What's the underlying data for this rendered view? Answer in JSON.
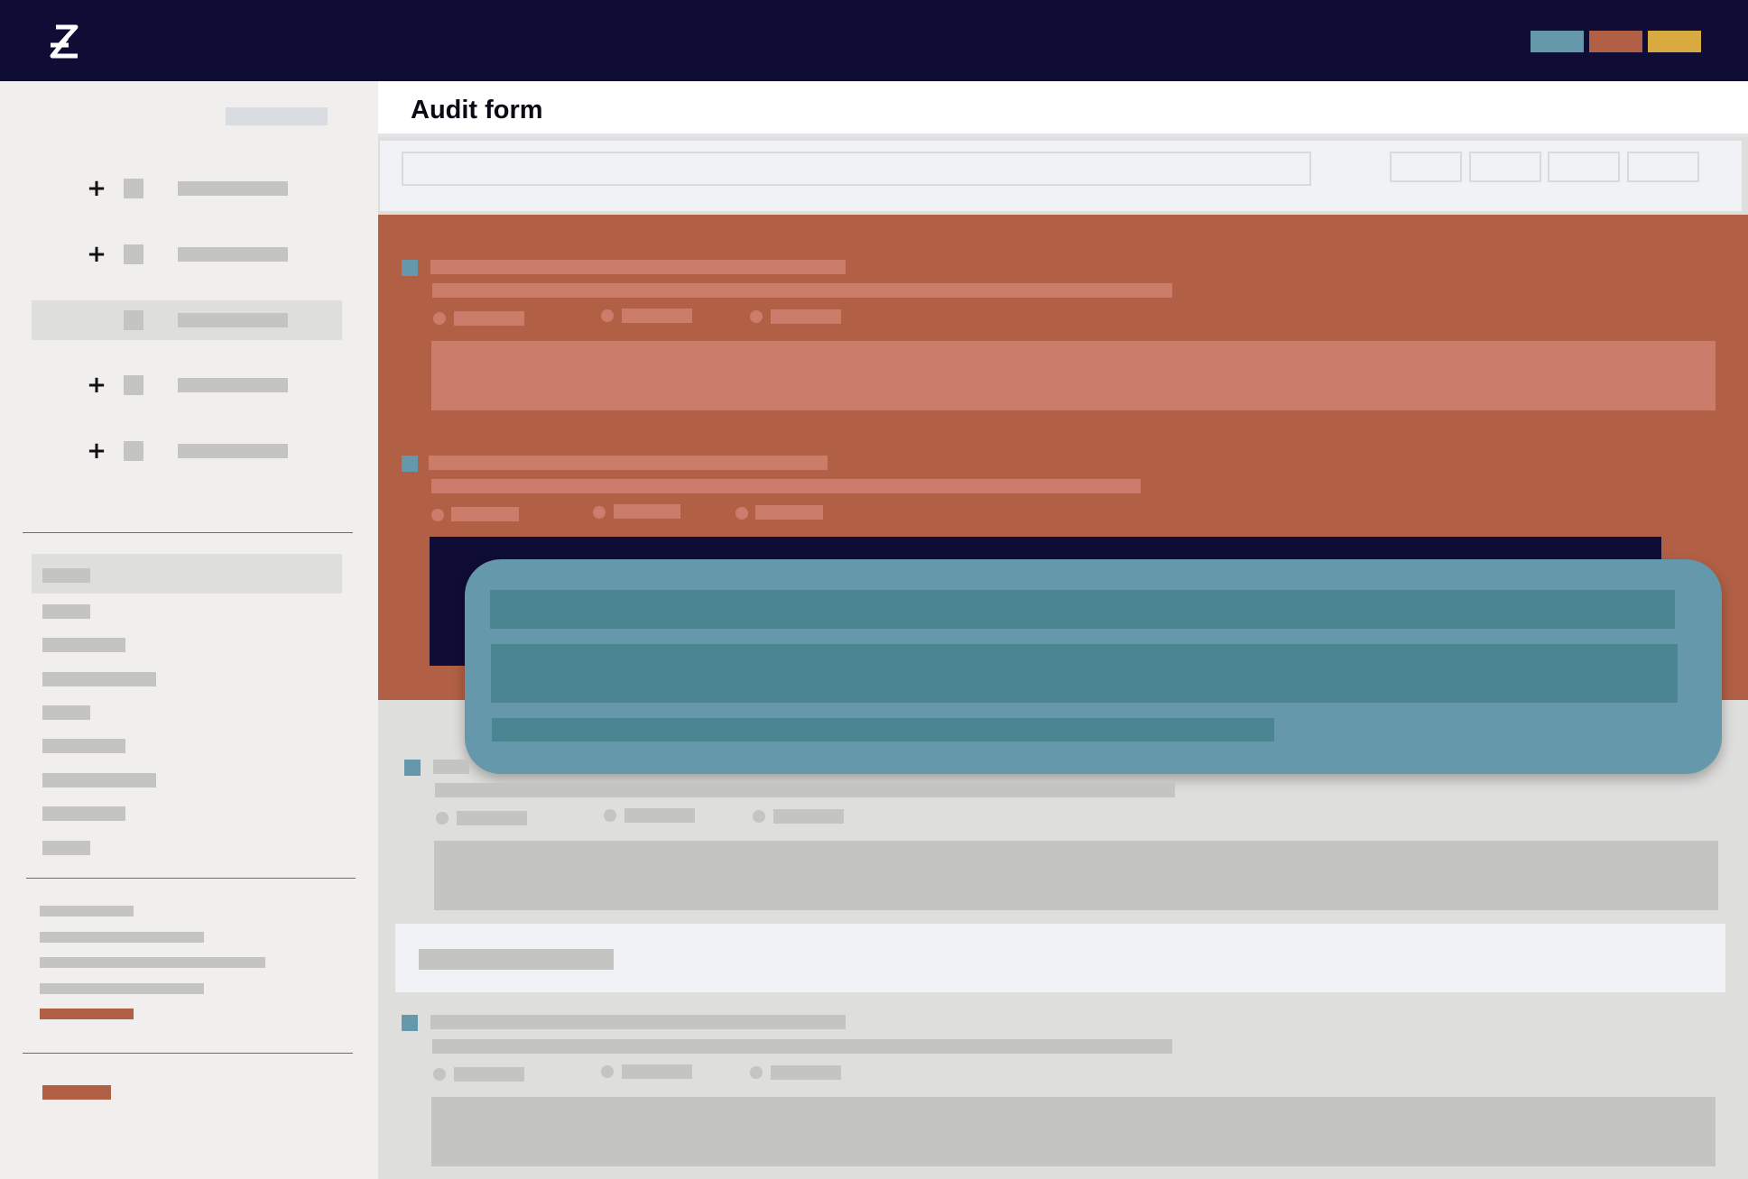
{
  "app": {
    "logo_icon": "z-logo-icon",
    "palette": {
      "blue": "#6698ac",
      "orange": "#b26045",
      "yellow": "#d9aa3f",
      "navy": "#0f0d36"
    }
  },
  "header": {
    "swatches": [
      "blue",
      "orange",
      "yellow"
    ]
  },
  "page": {
    "title": "Audit form"
  },
  "sidebar": {
    "tree_items": [
      {
        "expand_icon": "plus-icon",
        "expandable": true
      },
      {
        "expand_icon": "plus-icon",
        "expandable": true
      },
      {
        "expand_icon": "",
        "expandable": false,
        "selected": true
      },
      {
        "expand_icon": "plus-icon",
        "expandable": true
      },
      {
        "expand_icon": "plus-icon",
        "expandable": true
      }
    ],
    "plus_glyph": "+"
  }
}
